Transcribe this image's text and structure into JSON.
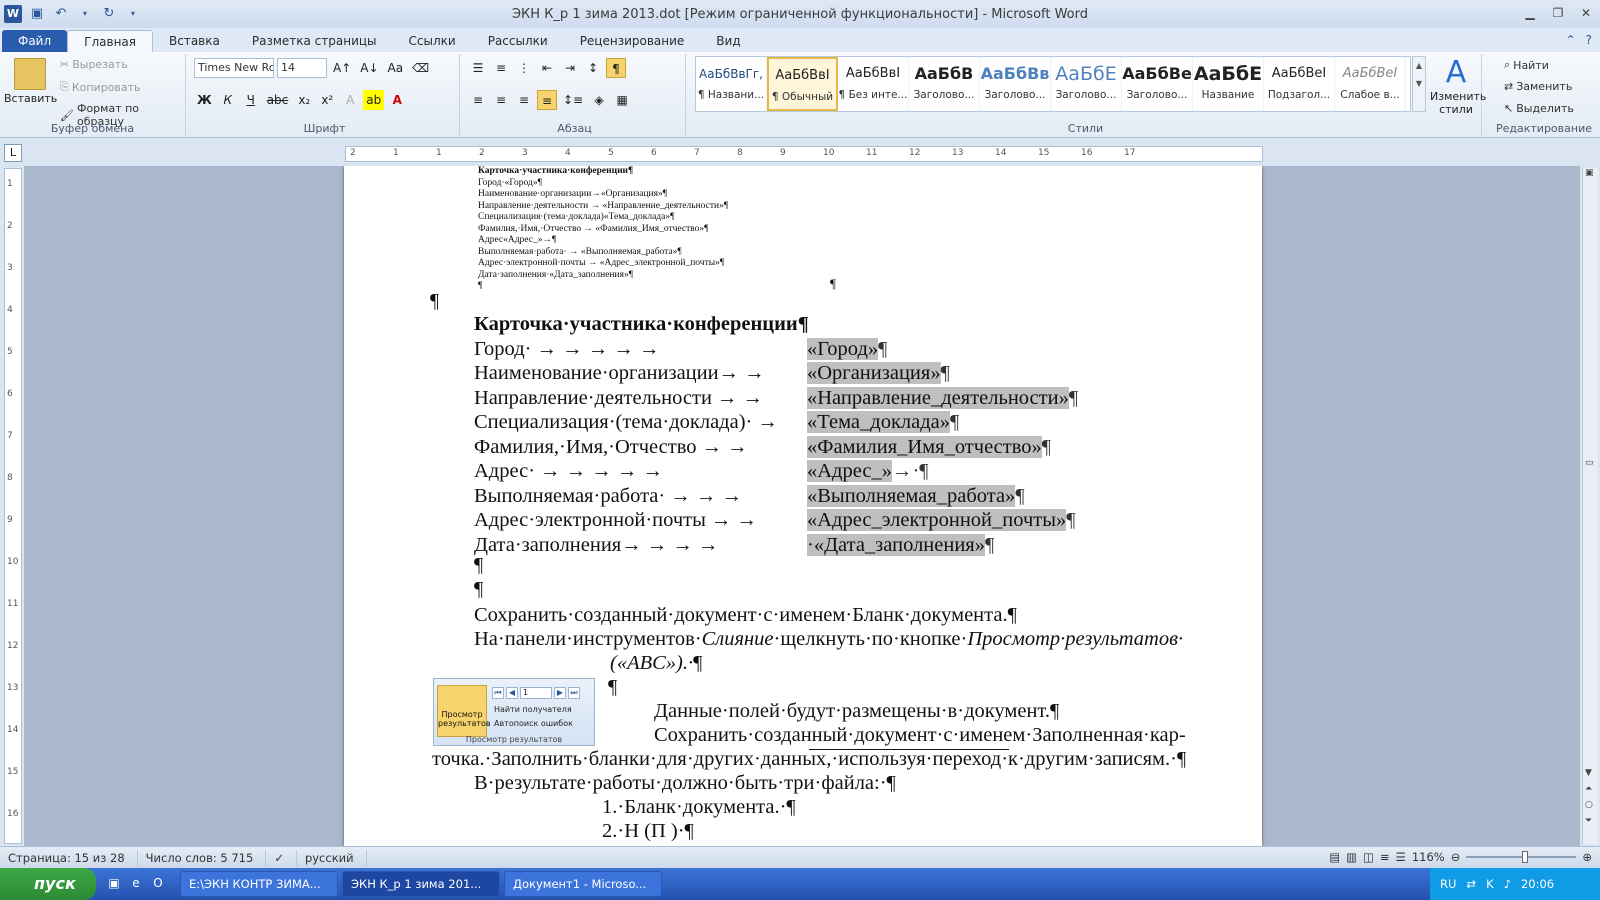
{
  "window": {
    "title": "ЭКН К_р 1 зима 2013.dot [Режим ограниченной функциональности]  -  Microsoft Word"
  },
  "tabs": {
    "file": "Файл",
    "home": "Главная",
    "insert": "Вставка",
    "layout": "Разметка страницы",
    "refs": "Ссылки",
    "mail": "Рассылки",
    "review": "Рецензирование",
    "view": "Вид"
  },
  "clipboard": {
    "paste": "Вставить",
    "cut": "Вырезать",
    "copy": "Копировать",
    "format": "Формат по образцу",
    "label": "Буфер обмена"
  },
  "font": {
    "name": "Times New Ro",
    "size": "14",
    "label": "Шрифт"
  },
  "paragraph": {
    "label": "Абзац"
  },
  "styles": {
    "label": "Стили",
    "change": "Изменить стили",
    "items": [
      {
        "sample": "АаБбВвГг,",
        "name": "¶ Названи..."
      },
      {
        "sample": "АаБбВвІ",
        "name": "¶ Обычный"
      },
      {
        "sample": "АаБбВвІ",
        "name": "¶ Без инте..."
      },
      {
        "sample": "АаБбВ",
        "name": "Заголово..."
      },
      {
        "sample": "АаБбВв",
        "name": "Заголово..."
      },
      {
        "sample": "АаБбЕ",
        "name": "Заголово..."
      },
      {
        "sample": "АаБбВе",
        "name": "Заголово..."
      },
      {
        "sample": "АаБбЕ",
        "name": "Название"
      },
      {
        "sample": "АаБбВеІ",
        "name": "Подзагол..."
      },
      {
        "sample": "АаБбВеІ",
        "name": "Слабое в..."
      }
    ]
  },
  "editing": {
    "find": "Найти",
    "replace": "Заменить",
    "select": "Выделить",
    "label": "Редактирование"
  },
  "ruler": {
    "h_ticks": [
      "2",
      "1",
      "1",
      "2",
      "3",
      "4",
      "5",
      "6",
      "7",
      "8",
      "9",
      "10",
      "11",
      "12",
      "13",
      "14",
      "15",
      "16",
      "17"
    ],
    "v_ticks": [
      "1",
      "2",
      "3",
      "4",
      "5",
      "6",
      "7",
      "8",
      "9",
      "10",
      "11",
      "12",
      "13",
      "14",
      "15",
      "16"
    ]
  },
  "doc": {
    "mini": [
      "Карточка·участника·конференции¶",
      "Город·«Город»¶",
      "Наименование·организации→«Организация»¶",
      "Направление·деятельности → «Направление_деятельности»¶",
      "Специализация·(тема·доклада)«Тема_доклада»¶",
      "Фамилия,·Имя,·Отчество → «Фамилия_Имя_отчество»¶",
      "Адрес«Адрес_»→¶",
      "Выполняемая·работа· → «Выполняемая_работа»¶",
      "Адрес·электронной·почты → «Адрес_электронной_почты»¶",
      "Дата·заполнения·«Дата_заполнения»¶",
      "¶"
    ],
    "mini_end": "¶",
    "pilcrow": "¶",
    "heading": "Карточка·участника·конференции¶",
    "rows": [
      {
        "label": "Город·   →       →       →       →       →",
        "value": "«Город»",
        "tail": "¶"
      },
      {
        "label": "Наименование·организации→   →",
        "value": "«Организация»",
        "tail": "¶"
      },
      {
        "label": "Направление·деятельности →   →",
        "value": "«Направление_деятельности»",
        "tail": "¶"
      },
      {
        "label": "Специализация·(тема·доклада)·   →",
        "value": "«Тема_доклада»",
        "tail": "¶"
      },
      {
        "label": "Фамилия,·Имя,·Отчество   →   →",
        "value": "«Фамилия_Имя_отчество»",
        "tail": "¶"
      },
      {
        "label": "Адрес·   →       →       →       →       →",
        "value": "«Адрес_»",
        "tail": "→·¶"
      },
      {
        "label": "Выполняемая·работа· →    →    →",
        "value": "«Выполняемая_работа»",
        "tail": "¶"
      },
      {
        "label": "Адрес·электронной·почты  →   →",
        "value": "«Адрес_электронной_почты»",
        "tail": "¶"
      },
      {
        "label": "Дата·заполнения→   →     →     →",
        "value": "·«Дата_заполнения»",
        "tail": "¶"
      }
    ],
    "body": {
      "l1": "Сохранить·созданный·документ·с·именем·Бланк·документа.¶",
      "l2a": "На·панели·инструментов·",
      "l2b": "Слияние",
      "l2c": "·щелкнуть·по·кнопке·",
      "l2d": "Просмотр·результатов·",
      "l3": "(«ABC»).·",
      "l3p": "¶",
      "l4": "¶",
      "l5": "Данные·полей·будут·размещены·в·документ.¶",
      "l6": "Сохранить·созданный·документ·с·именем·Заполненная·кар-",
      "l7": "точка.·Заполнить·бланки·для·других·данных,·используя·переход·к·другим·записям.·¶",
      "l8": "В·результате·работы·должно·быть·три·файла:·¶",
      "l9": "1.·Бланк·документа.·¶",
      "l10": "2.·Н                           (П    )·¶"
    },
    "preview": {
      "big": "Просмотр результатов",
      "num": "1",
      "find": "Найти получателя",
      "check": "Автопоиск ошибок",
      "caption": "Просмотр результатов"
    }
  },
  "status": {
    "page": "Страница: 15 из 28",
    "words": "Число слов: 5 715",
    "lang": "русский",
    "zoom": "116%"
  },
  "taskbar": {
    "start": "пуск",
    "items": [
      "E:\\ЭКН КОНТР ЗИМА...",
      "ЭКН К_р 1 зима 201...",
      "Документ1 - Microso..."
    ],
    "lang": "RU",
    "time": "20:06"
  }
}
